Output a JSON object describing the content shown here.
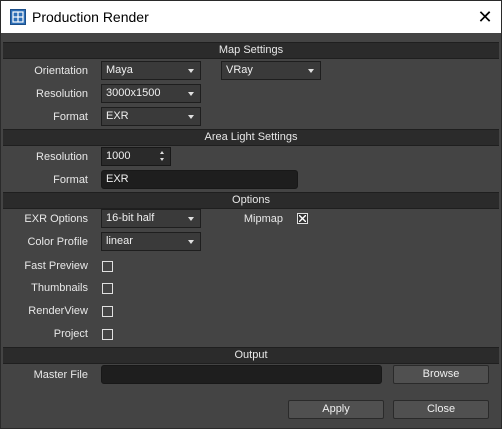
{
  "window": {
    "title": "Production Render",
    "close_glyph": "✕",
    "app_icon": "render-app-icon"
  },
  "sections": {
    "map_settings": "Map Settings",
    "area_light_settings": "Area Light Settings",
    "options": "Options",
    "output": "Output"
  },
  "map_settings": {
    "orientation_label": "Orientation",
    "orientation_value": "Maya",
    "renderer_value": "VRay",
    "resolution_label": "Resolution",
    "resolution_value": "3000x1500",
    "format_label": "Format",
    "format_value": "EXR"
  },
  "area_light_settings": {
    "resolution_label": "Resolution",
    "resolution_value": "1000",
    "format_label": "Format",
    "format_value": "EXR"
  },
  "options": {
    "exr_options_label": "EXR Options",
    "exr_options_value": "16-bit half",
    "mipmap_label": "Mipmap",
    "mipmap_checked": true,
    "color_profile_label": "Color Profile",
    "color_profile_value": "linear",
    "fast_preview_label": "Fast Preview",
    "fast_preview_checked": false,
    "thumbnails_label": "Thumbnails",
    "thumbnails_checked": false,
    "renderview_label": "RenderView",
    "renderview_checked": false,
    "project_label": "Project",
    "project_checked": false
  },
  "output": {
    "master_file_label": "Master File",
    "master_file_value": "",
    "browse_label": "Browse"
  },
  "footer": {
    "apply_label": "Apply",
    "close_label": "Close"
  }
}
